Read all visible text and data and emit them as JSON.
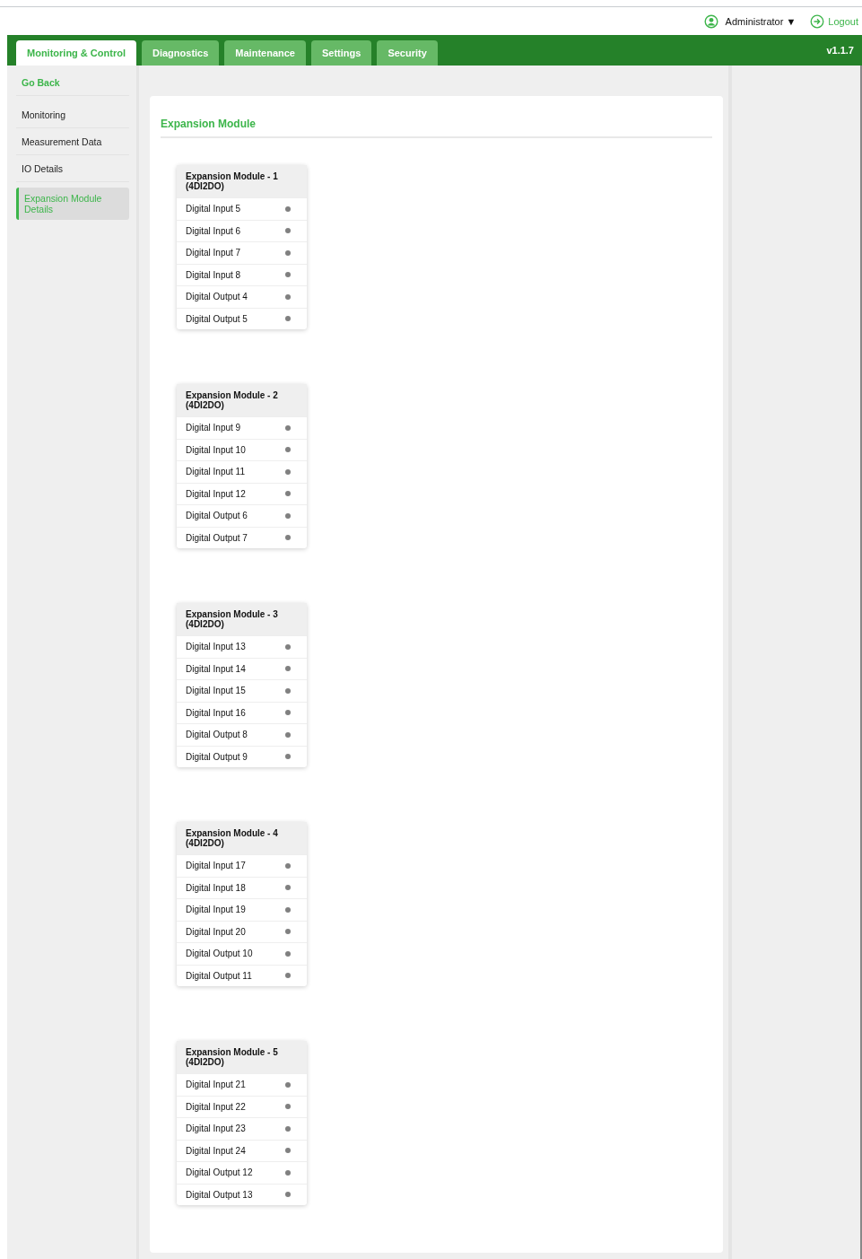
{
  "user_menu": {
    "user": "Administrator ▼",
    "logout": "Logout"
  },
  "tabs": [
    {
      "label": "Monitoring & Control",
      "selected": true
    },
    {
      "label": "Diagnostics",
      "selected": false
    },
    {
      "label": "Maintenance",
      "selected": false
    },
    {
      "label": "Settings",
      "selected": false
    },
    {
      "label": "Security",
      "selected": false
    }
  ],
  "version": "v1.1.7",
  "sidebar": {
    "back": "Go Back",
    "items": [
      {
        "label": "Monitoring",
        "selected": false
      },
      {
        "label": "Measurement Data",
        "selected": false
      },
      {
        "label": "IO Details",
        "selected": false
      },
      {
        "label": "Expansion Module Details",
        "selected": true
      }
    ]
  },
  "page_title": "Expansion Module",
  "modules": [
    {
      "title": "Expansion Module - 1 (4DI2DO)",
      "signals": [
        {
          "name": "Digital Input 5",
          "on": false
        },
        {
          "name": "Digital Input 6",
          "on": false
        },
        {
          "name": "Digital Input 7",
          "on": false
        },
        {
          "name": "Digital Input 8",
          "on": false
        },
        {
          "name": "Digital Output 4",
          "on": false
        },
        {
          "name": "Digital Output 5",
          "on": false
        }
      ]
    },
    {
      "title": "Expansion Module - 2 (4DI2DO)",
      "signals": [
        {
          "name": "Digital Input 9",
          "on": false
        },
        {
          "name": "Digital Input 10",
          "on": false
        },
        {
          "name": "Digital Input 11",
          "on": false
        },
        {
          "name": "Digital Input 12",
          "on": false
        },
        {
          "name": "Digital Output 6",
          "on": false
        },
        {
          "name": "Digital Output 7",
          "on": false
        }
      ]
    },
    {
      "title": "Expansion Module - 3 (4DI2DO)",
      "signals": [
        {
          "name": "Digital Input 13",
          "on": false
        },
        {
          "name": "Digital Input 14",
          "on": false
        },
        {
          "name": "Digital Input 15",
          "on": false
        },
        {
          "name": "Digital Input 16",
          "on": false
        },
        {
          "name": "Digital Output 8",
          "on": false
        },
        {
          "name": "Digital Output 9",
          "on": false
        }
      ]
    },
    {
      "title": "Expansion Module - 4 (4DI2DO)",
      "signals": [
        {
          "name": "Digital Input 17",
          "on": false
        },
        {
          "name": "Digital Input 18",
          "on": false
        },
        {
          "name": "Digital Input 19",
          "on": false
        },
        {
          "name": "Digital Input 20",
          "on": false
        },
        {
          "name": "Digital Output 10",
          "on": false
        },
        {
          "name": "Digital Output 11",
          "on": false
        }
      ]
    },
    {
      "title": "Expansion Module - 5 (4DI2DO)",
      "signals": [
        {
          "name": "Digital Input 21",
          "on": false
        },
        {
          "name": "Digital Input 22",
          "on": false
        },
        {
          "name": "Digital Input 23",
          "on": false
        },
        {
          "name": "Digital Input 24",
          "on": false
        },
        {
          "name": "Digital Output 12",
          "on": false
        },
        {
          "name": "Digital Output 13",
          "on": false
        }
      ]
    }
  ]
}
